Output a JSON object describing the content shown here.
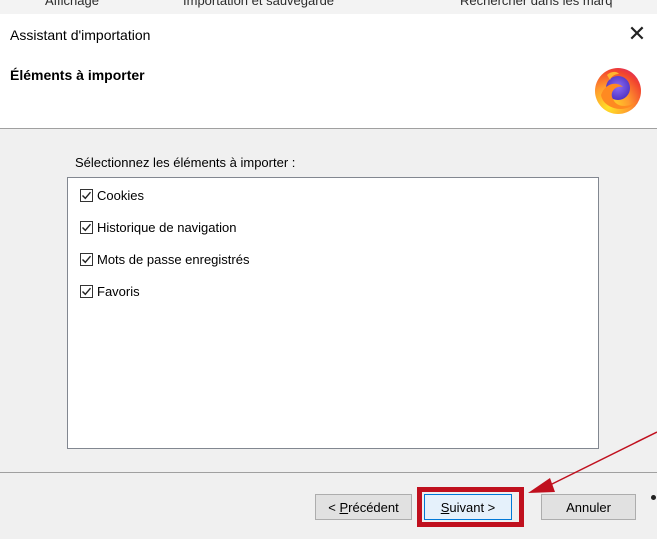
{
  "background_toolbar": {
    "item1": "Affichage",
    "item2": "Importation et sauvegarde",
    "item3": "Rechercher dans les marq"
  },
  "dialog": {
    "title": "Assistant d'importation",
    "close_glyph": "✕",
    "header_title": "Éléments à importer",
    "logo_icon": "firefox-logo",
    "select_label": "Sélectionnez les éléments à importer :",
    "items": [
      {
        "label": "Cookies",
        "checked": true
      },
      {
        "label": "Historique de navigation",
        "checked": true
      },
      {
        "label": "Mots de passe enregistrés",
        "checked": true
      },
      {
        "label": "Favoris",
        "checked": true
      }
    ],
    "buttons": {
      "previous": {
        "prefix": "< ",
        "mnemonic": "P",
        "rest": "récédent"
      },
      "next": {
        "mnemonic": "S",
        "rest": "uivant >"
      },
      "cancel": "Annuler"
    }
  },
  "annotation": {
    "highlight_color": "#c0101e",
    "highlights": "next-button"
  },
  "colors": {
    "content_bg": "#f0f0f0",
    "accent": "#0078d7"
  }
}
